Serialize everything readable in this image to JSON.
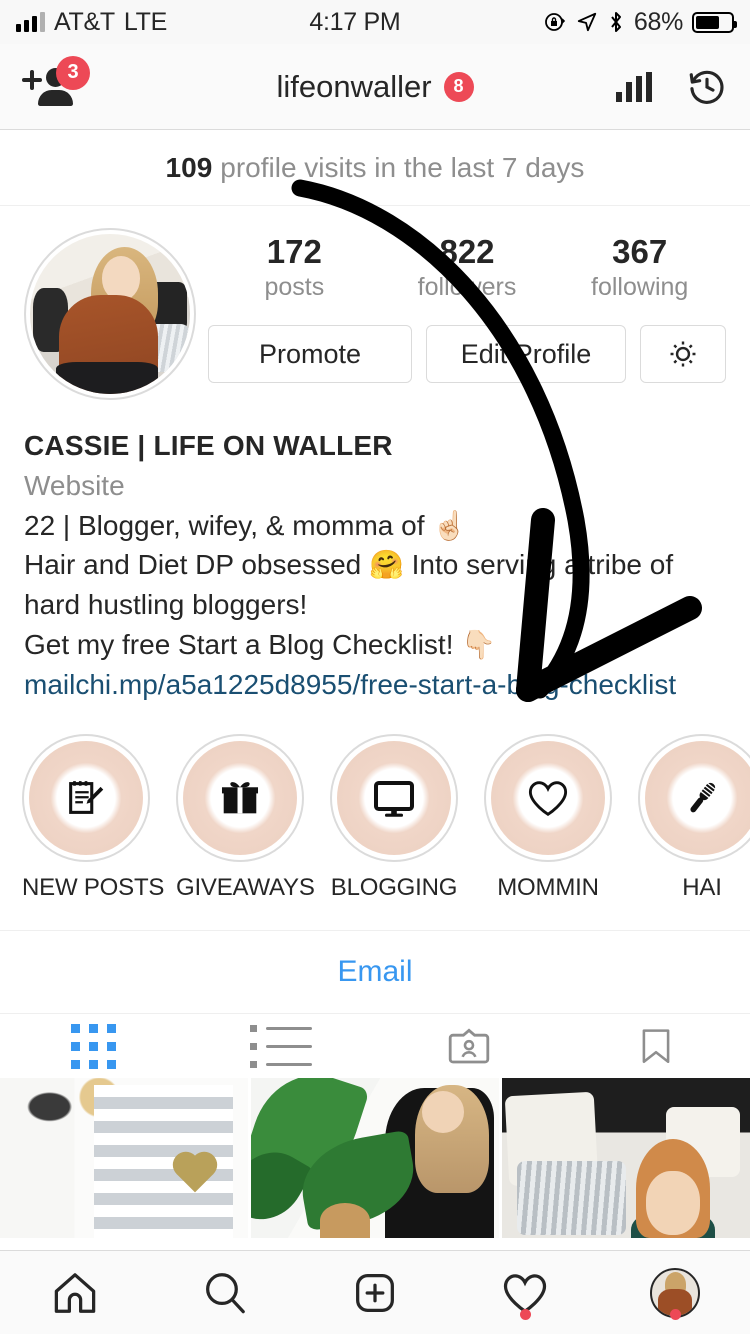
{
  "status_bar": {
    "carrier": "AT&T",
    "network": "LTE",
    "time": "4:17 PM",
    "battery_percent": "68%",
    "icons": [
      "signal-bars-icon",
      "rotation-lock-icon",
      "location-arrow-icon",
      "bluetooth-icon",
      "battery-icon"
    ]
  },
  "nav": {
    "username": "lifeonwaller",
    "username_badge": "8",
    "add_person_badge": "3",
    "left_icon": "add-person-icon",
    "right_icons": [
      "insights-bar-chart-icon",
      "archive-clock-icon"
    ]
  },
  "visits_banner": {
    "count": "109",
    "text": "profile visits in the last 7 days"
  },
  "profile": {
    "stats": [
      {
        "number": "172",
        "label": "posts"
      },
      {
        "number": "822",
        "label": "followers"
      },
      {
        "number": "367",
        "label": "following"
      }
    ],
    "buttons": {
      "promote": "Promote",
      "edit_profile": "Edit Profile",
      "settings_icon": "gear-icon"
    },
    "display_name": "CASSIE  | LIFE ON WALLER",
    "category": "Website",
    "bio": "22 | Blogger, wifey, & momma of ☝🏻\nHair and Diet DP obsessed 🤗 Into serving a tribe of hard hustling bloggers!\nGet my free Start a Blog Checklist! 👇🏻",
    "link": "mailchi.mp/a5a1225d8955/free-start-a-blog-checklist"
  },
  "highlights": [
    {
      "label": "NEW POSTS",
      "icon": "notepad-pencil-icon"
    },
    {
      "label": "GIVEAWAYS",
      "icon": "gift-icon"
    },
    {
      "label": "BLOGGING",
      "icon": "monitor-icon"
    },
    {
      "label": "MOMMIN",
      "icon": "heart-icon"
    },
    {
      "label": "HAI",
      "icon": "hairbrush-icon"
    }
  ],
  "contact": {
    "email_label": "Email"
  },
  "tabs": [
    {
      "name": "grid",
      "icon": "grid-icon",
      "active": true
    },
    {
      "name": "list",
      "icon": "list-icon",
      "active": false
    },
    {
      "name": "tagged",
      "icon": "tagged-person-icon",
      "active": false
    },
    {
      "name": "saved",
      "icon": "bookmark-icon",
      "active": false
    }
  ],
  "bottom_nav": [
    {
      "name": "home",
      "icon": "home-icon",
      "notification": false
    },
    {
      "name": "search",
      "icon": "search-icon",
      "notification": false
    },
    {
      "name": "add-post",
      "icon": "plus-square-icon",
      "notification": false
    },
    {
      "name": "activity",
      "icon": "heart-icon",
      "notification": true
    },
    {
      "name": "profile",
      "icon": "avatar-icon",
      "notification": true
    }
  ],
  "colors": {
    "accent_blue": "#3897f0",
    "badge_red": "#ed4956",
    "link_blue": "#1a4f72",
    "highlight_peach": "#eccfc0",
    "text_primary": "#262626",
    "text_secondary": "#8e8e8e"
  },
  "annotation": {
    "type": "hand-drawn-arrow",
    "color": "#000000",
    "description": "curved arrow from profile visits banner down to bio link"
  }
}
